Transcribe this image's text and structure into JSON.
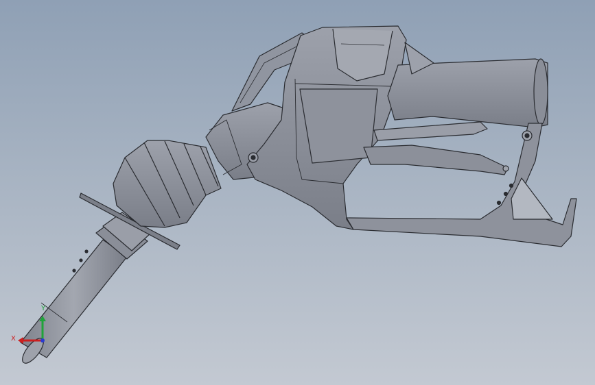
{
  "colors": {
    "background_top": "#8fa0b5",
    "background_bottom": "#c3c9d2",
    "model_fill": "#8e929d",
    "model_shade": "#6f737d",
    "edge": "#2a2c31",
    "axis_x": "#cc1f1f",
    "axis_y": "#1fa33a",
    "axis_z": "#2a3bd0"
  },
  "triad": {
    "x_label": "X",
    "y_label": "Y"
  }
}
